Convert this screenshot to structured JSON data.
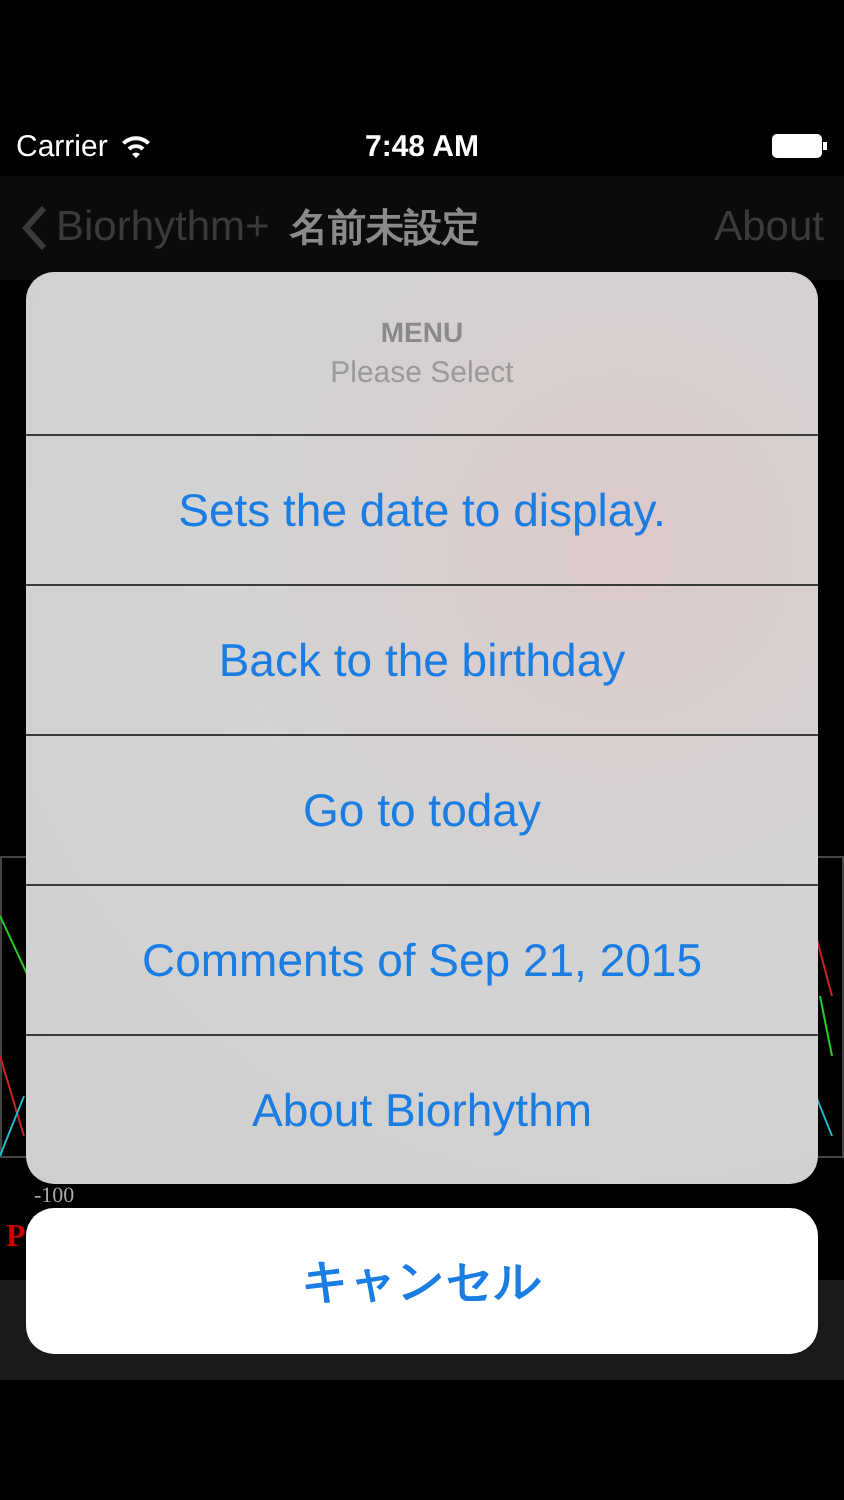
{
  "status_bar": {
    "carrier": "Carrier",
    "time": "7:48 AM"
  },
  "nav_bar": {
    "back_label": "Biorhythm+",
    "title": "名前未設定",
    "right_button": "About"
  },
  "chart": {
    "axis_label": "-100",
    "legend_letter": "P"
  },
  "action_sheet": {
    "title": "MENU",
    "message": "Please Select",
    "actions": [
      {
        "label": "Sets the date to display."
      },
      {
        "label": "Back to the birthday"
      },
      {
        "label": "Go to today"
      },
      {
        "label": "Comments of Sep 21, 2015"
      },
      {
        "label": "About Biorhythm"
      }
    ],
    "cancel": "キャンセル"
  }
}
